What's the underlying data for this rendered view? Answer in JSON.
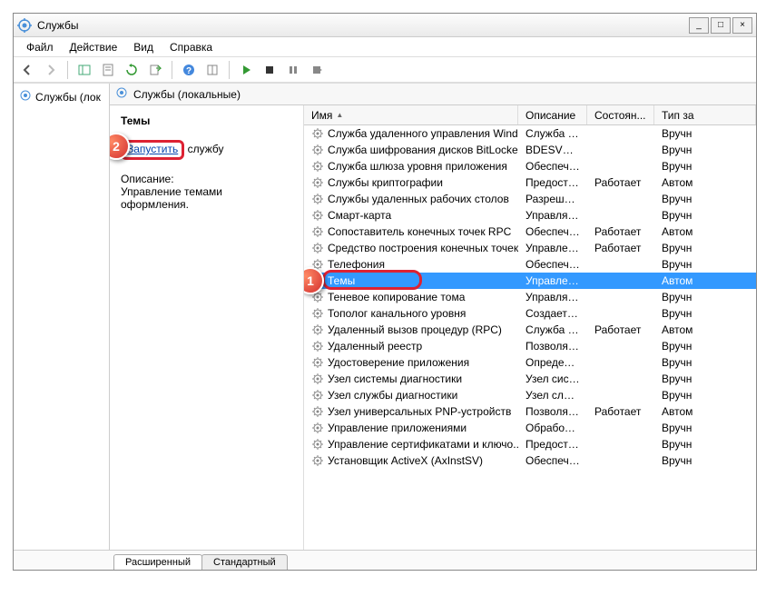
{
  "window": {
    "title": "Службы"
  },
  "menu": {
    "file": "Файл",
    "action": "Действие",
    "view": "Вид",
    "help": "Справка"
  },
  "tree": {
    "root": "Службы (лок"
  },
  "panel": {
    "header": "Службы (локальные)"
  },
  "detail": {
    "name": "Темы",
    "action_link": "Запустить",
    "action_suffix": " службу",
    "desc_label": "Описание:",
    "desc": "Управление темами оформления."
  },
  "columns": {
    "name": "Имя",
    "desc": "Описание",
    "state": "Состоян...",
    "type": "Тип за"
  },
  "services": [
    {
      "name": "Служба удаленного управления Wind...",
      "desc": "Служба уд...",
      "state": "",
      "type": "Вручн",
      "selected": false
    },
    {
      "name": "Служба шифрования дисков BitLocker",
      "desc": "BDESVC ...",
      "state": "",
      "type": "Вручн",
      "selected": false
    },
    {
      "name": "Служба шлюза уровня приложения",
      "desc": "Обеспечи...",
      "state": "",
      "type": "Вручн",
      "selected": false
    },
    {
      "name": "Службы криптографии",
      "desc": "Предоста...",
      "state": "Работает",
      "type": "Автом",
      "selected": false
    },
    {
      "name": "Службы удаленных рабочих столов",
      "desc": "Разрешае...",
      "state": "",
      "type": "Вручн",
      "selected": false
    },
    {
      "name": "Смарт-карта",
      "desc": "Управляет...",
      "state": "",
      "type": "Вручн",
      "selected": false
    },
    {
      "name": "Сопоставитель конечных точек RPC",
      "desc": "Обеспечи...",
      "state": "Работает",
      "type": "Автом",
      "selected": false
    },
    {
      "name": "Средство построения конечных точек...",
      "desc": "Управлен...",
      "state": "Работает",
      "type": "Вручн",
      "selected": false
    },
    {
      "name": "Телефония",
      "desc": "Обеспечи...",
      "state": "",
      "type": "Вручн",
      "selected": false
    },
    {
      "name": "Темы",
      "desc": "Управлен...",
      "state": "",
      "type": "Автом",
      "selected": true
    },
    {
      "name": "Теневое копирование тома",
      "desc": "Управляет...",
      "state": "",
      "type": "Вручн",
      "selected": false
    },
    {
      "name": "Тополог канального уровня",
      "desc": "Создает к...",
      "state": "",
      "type": "Вручн",
      "selected": false
    },
    {
      "name": "Удаленный вызов процедур (RPC)",
      "desc": "Служба R...",
      "state": "Работает",
      "type": "Автом",
      "selected": false
    },
    {
      "name": "Удаленный реестр",
      "desc": "Позволяе...",
      "state": "",
      "type": "Вручн",
      "selected": false
    },
    {
      "name": "Удостоверение приложения",
      "desc": "Определя...",
      "state": "",
      "type": "Вручн",
      "selected": false
    },
    {
      "name": "Узел системы диагностики",
      "desc": "Узел сист...",
      "state": "",
      "type": "Вручн",
      "selected": false
    },
    {
      "name": "Узел службы диагностики",
      "desc": "Узел служ...",
      "state": "",
      "type": "Вручн",
      "selected": false
    },
    {
      "name": "Узел универсальных PNP-устройств",
      "desc": "Позволяе...",
      "state": "Работает",
      "type": "Автом",
      "selected": false
    },
    {
      "name": "Управление приложениями",
      "desc": "Обработк...",
      "state": "",
      "type": "Вручн",
      "selected": false
    },
    {
      "name": "Управление сертификатами и ключо...",
      "desc": "Предоста...",
      "state": "",
      "type": "Вручн",
      "selected": false
    },
    {
      "name": "Установщик ActiveX (AxInstSV)",
      "desc": "Обеспечи...",
      "state": "",
      "type": "Вручн",
      "selected": false
    }
  ],
  "tabs": {
    "extended": "Расширенный",
    "standard": "Стандартный"
  },
  "callouts": {
    "one": "1",
    "two": "2"
  }
}
